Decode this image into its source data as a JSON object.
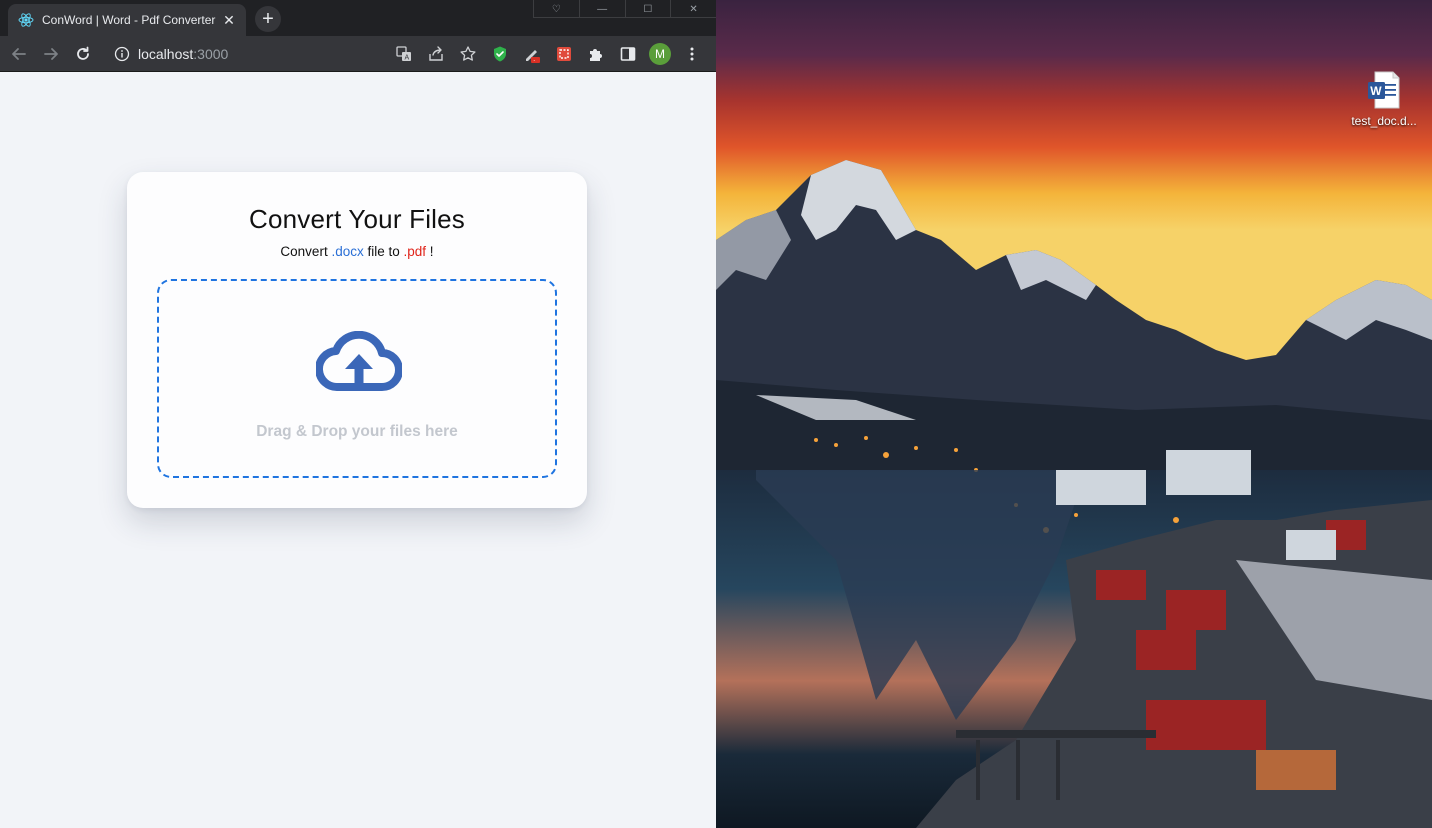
{
  "browser": {
    "tab": {
      "title": "ConWord | Word - Pdf Converter",
      "close": "✕"
    },
    "new_tab": "+",
    "window_controls": {
      "minimize": "—",
      "maximize": "☐",
      "close": "✕"
    },
    "address": {
      "host": "localhost",
      "port": ":3000"
    },
    "avatar_letter": "M",
    "toolbar_icons": [
      "translate-icon",
      "share-icon",
      "bookmark-star-icon",
      "shield-extension-icon",
      "pen-extension-icon",
      "screenshot-extension-icon",
      "puzzle-extensions-icon",
      "sidepanel-icon",
      "avatar",
      "kebab-menu-icon"
    ]
  },
  "page": {
    "title": "Convert Your Files",
    "subtitle_prefix": "Convert ",
    "from_ext": ".docx",
    "subtitle_mid": " file to ",
    "to_ext": ".pdf",
    "subtitle_suffix": " !",
    "drop_text": "Drag & Drop your files here"
  },
  "desktop": {
    "file_label": "test_doc.d..."
  },
  "colors": {
    "accent_blue": "#1f74e0",
    "docx_blue": "#2a6fd6",
    "pdf_red": "#e0241a",
    "cloud_icon": "#3b67b8"
  }
}
